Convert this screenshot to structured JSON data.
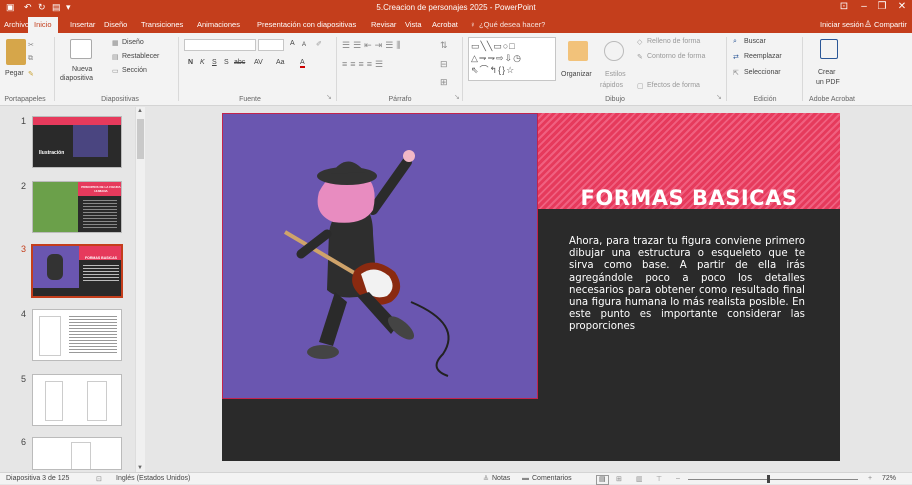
{
  "app": {
    "window_title": "5.Creacion de personajes 2025 - PowerPoint",
    "sign_in": "Iniciar sesión",
    "share": "Compartir"
  },
  "tabs": [
    "Archivo",
    "Inicio",
    "Insertar",
    "Diseño",
    "Transiciones",
    "Animaciones",
    "Presentación con diapositivas",
    "Revisar",
    "Vista",
    "Acrobat"
  ],
  "tell_me": "¿Qué desea hacer?",
  "ribbon": {
    "portapapeles": {
      "label": "Portapapeles",
      "pegar": "Pegar"
    },
    "diapositivas": {
      "label": "Diapositivas",
      "nueva_1": "Nueva",
      "nueva_2": "diapositiva",
      "diseno": "Diseño",
      "restablecer": "Restablecer",
      "seccion": "Sección"
    },
    "fuente": {
      "label": "Fuente",
      "bold": "N",
      "italic": "K",
      "underline": "S",
      "shadow": "S",
      "strike": "abc",
      "spacing": "AV",
      "case": "Aa",
      "color": "A",
      "grow": "A",
      "shrink": "A"
    },
    "parrafo": {
      "label": "Párrafo"
    },
    "dibujo": {
      "label": "Dibujo",
      "organizar": "Organizar",
      "estilos_1": "Estilos",
      "estilos_2": "rápidos",
      "relleno": "Relleno de forma",
      "contorno": "Contorno de forma",
      "efectos": "Efectos de forma"
    },
    "edicion": {
      "label": "Edición",
      "buscar": "Buscar",
      "reemplazar": "Reemplazar",
      "seleccionar": "Seleccionar"
    },
    "acrobat": {
      "label": "Adobe Acrobat",
      "crear_1": "Crear",
      "crear_2": "un PDF"
    }
  },
  "thumbnails": [
    {
      "num": "1",
      "title": "Ilustración"
    },
    {
      "num": "2",
      "title": "PRINCIPIOS DE LA FIGURA HUMANA"
    },
    {
      "num": "3",
      "title": "FORMAS BASICAS"
    },
    {
      "num": "4"
    },
    {
      "num": "5"
    },
    {
      "num": "6"
    }
  ],
  "slide": {
    "title": "FORMAS BASICAS",
    "body": "Ahora, para trazar tu figura conviene primero dibujar una estructura o esqueleto que te sirva como base. A partir de ella irás agregándole poco a poco los detalles necesarios para obtener como resultado final una figura humana lo más realista posible. En este punto es importante considerar las proporciones"
  },
  "status": {
    "slide_info": "Diapositiva 3 de 125",
    "language": "Inglés (Estados Unidos)",
    "notes": "Notas",
    "comments": "Comentarios",
    "zoom": "72%"
  },
  "colors": {
    "accent": "#c43e1c",
    "slide_dark": "#2a2a2a",
    "slide_purple": "#6a56b0",
    "slide_pink": "#e63a5c"
  }
}
